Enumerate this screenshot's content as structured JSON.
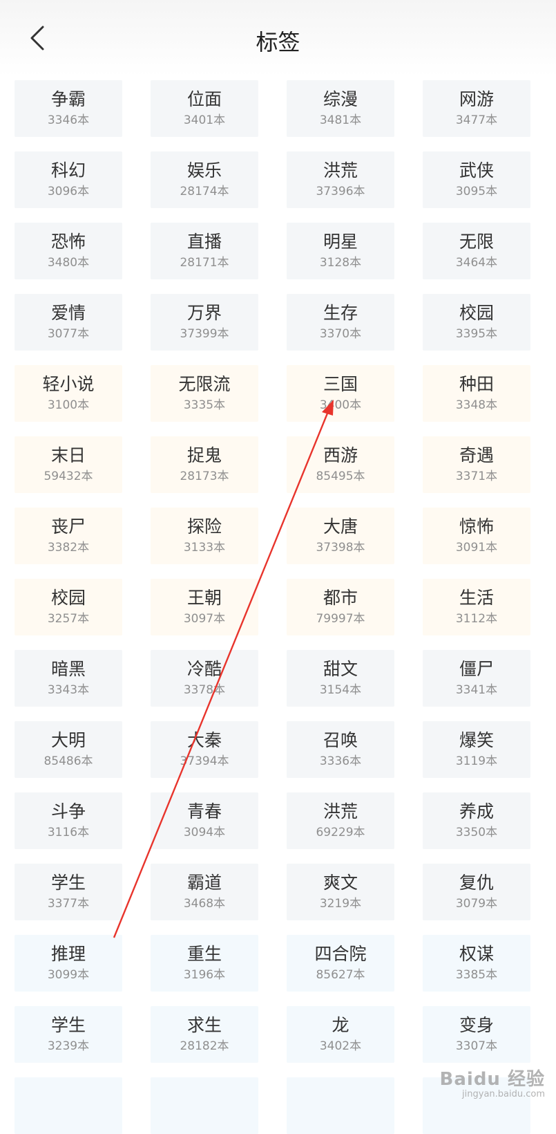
{
  "header": {
    "title": "标签",
    "back_icon": "chevron-left-icon"
  },
  "colors": {
    "gray_tag": "#f4f6f8",
    "cream_tag": "#fffaf2",
    "blue_tag": "#f3f9fd",
    "arrow": "#e8342c"
  },
  "tags": [
    {
      "name": "争霸",
      "count": "3346本",
      "tone": "gray"
    },
    {
      "name": "位面",
      "count": "3401本",
      "tone": "gray"
    },
    {
      "name": "综漫",
      "count": "3481本",
      "tone": "gray"
    },
    {
      "name": "网游",
      "count": "3477本",
      "tone": "gray"
    },
    {
      "name": "科幻",
      "count": "3096本",
      "tone": "gray"
    },
    {
      "name": "娱乐",
      "count": "28174本",
      "tone": "gray"
    },
    {
      "name": "洪荒",
      "count": "37396本",
      "tone": "gray"
    },
    {
      "name": "武侠",
      "count": "3095本",
      "tone": "gray"
    },
    {
      "name": "恐怖",
      "count": "3480本",
      "tone": "gray"
    },
    {
      "name": "直播",
      "count": "28171本",
      "tone": "gray"
    },
    {
      "name": "明星",
      "count": "3128本",
      "tone": "gray"
    },
    {
      "name": "无限",
      "count": "3464本",
      "tone": "gray"
    },
    {
      "name": "爱情",
      "count": "3077本",
      "tone": "gray"
    },
    {
      "name": "万界",
      "count": "37399本",
      "tone": "gray"
    },
    {
      "name": "生存",
      "count": "3370本",
      "tone": "gray"
    },
    {
      "name": "校园",
      "count": "3395本",
      "tone": "gray"
    },
    {
      "name": "轻小说",
      "count": "3100本",
      "tone": "cream"
    },
    {
      "name": "无限流",
      "count": "3335本",
      "tone": "cream"
    },
    {
      "name": "三国",
      "count": "3400本",
      "tone": "cream"
    },
    {
      "name": "种田",
      "count": "3348本",
      "tone": "cream"
    },
    {
      "name": "末日",
      "count": "59432本",
      "tone": "cream"
    },
    {
      "name": "捉鬼",
      "count": "28173本",
      "tone": "cream"
    },
    {
      "name": "西游",
      "count": "85495本",
      "tone": "cream"
    },
    {
      "name": "奇遇",
      "count": "3371本",
      "tone": "cream"
    },
    {
      "name": "丧尸",
      "count": "3382本",
      "tone": "cream"
    },
    {
      "name": "探险",
      "count": "3133本",
      "tone": "cream"
    },
    {
      "name": "大唐",
      "count": "37398本",
      "tone": "cream"
    },
    {
      "name": "惊怖",
      "count": "3091本",
      "tone": "cream"
    },
    {
      "name": "校园",
      "count": "3257本",
      "tone": "cream"
    },
    {
      "name": "王朝",
      "count": "3097本",
      "tone": "cream"
    },
    {
      "name": "都市",
      "count": "79997本",
      "tone": "cream"
    },
    {
      "name": "生活",
      "count": "3112本",
      "tone": "cream"
    },
    {
      "name": "暗黑",
      "count": "3343本",
      "tone": "gray"
    },
    {
      "name": "冷酷",
      "count": "3378本",
      "tone": "gray"
    },
    {
      "name": "甜文",
      "count": "3154本",
      "tone": "gray"
    },
    {
      "name": "僵尸",
      "count": "3341本",
      "tone": "gray"
    },
    {
      "name": "大明",
      "count": "85486本",
      "tone": "gray"
    },
    {
      "name": "大秦",
      "count": "37394本",
      "tone": "gray"
    },
    {
      "name": "召唤",
      "count": "3336本",
      "tone": "gray"
    },
    {
      "name": "爆笑",
      "count": "3119本",
      "tone": "gray"
    },
    {
      "name": "斗争",
      "count": "3116本",
      "tone": "gray"
    },
    {
      "name": "青春",
      "count": "3094本",
      "tone": "gray"
    },
    {
      "name": "洪荒",
      "count": "69229本",
      "tone": "gray"
    },
    {
      "name": "养成",
      "count": "3350本",
      "tone": "gray"
    },
    {
      "name": "学生",
      "count": "3377本",
      "tone": "gray"
    },
    {
      "name": "霸道",
      "count": "3468本",
      "tone": "gray"
    },
    {
      "name": "爽文",
      "count": "3219本",
      "tone": "gray"
    },
    {
      "name": "复仇",
      "count": "3079本",
      "tone": "gray"
    },
    {
      "name": "推理",
      "count": "3099本",
      "tone": "blue"
    },
    {
      "name": "重生",
      "count": "3196本",
      "tone": "blue"
    },
    {
      "name": "四合院",
      "count": "85627本",
      "tone": "blue"
    },
    {
      "name": "权谋",
      "count": "3385本",
      "tone": "blue"
    },
    {
      "name": "学生",
      "count": "3239本",
      "tone": "blue"
    },
    {
      "name": "求生",
      "count": "28182本",
      "tone": "blue"
    },
    {
      "name": "龙",
      "count": "3402本",
      "tone": "blue"
    },
    {
      "name": "变身",
      "count": "3307本",
      "tone": "blue"
    },
    {
      "name": "",
      "count": "",
      "tone": "blue"
    },
    {
      "name": "",
      "count": "",
      "tone": "blue"
    },
    {
      "name": "",
      "count": "",
      "tone": "blue"
    },
    {
      "name": "",
      "count": "",
      "tone": "blue"
    }
  ],
  "watermark": {
    "main": "Baidu 经验",
    "sub": "jingyan.baidu.com"
  }
}
